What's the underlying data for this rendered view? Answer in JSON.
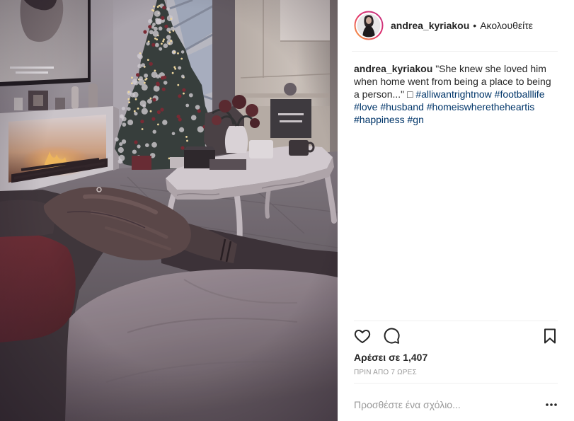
{
  "header": {
    "username": "andrea_kyriakou",
    "separator": "•",
    "follow_status": "Ακολουθείτε"
  },
  "caption": {
    "username": "andrea_kyriakou",
    "text": "\"She knew she loved him when home went from being a place to being a person...\" □",
    "hashtags": [
      "#alliwantrightnow",
      "#footballlife",
      "#love",
      "#husband",
      "#homeiswheretheheartis",
      "#happiness",
      "#gn"
    ]
  },
  "actions": {
    "like_icon": "heart-icon",
    "comment_icon": "comment-icon",
    "save_icon": "bookmark-icon"
  },
  "likes": {
    "text": "Αρέσει σε 1,407"
  },
  "timestamp": {
    "text": "ΠΡΙΝ ΑΠΟ 7 ΩΡΕΣ"
  },
  "comment_box": {
    "placeholder": "Προσθέστε ένα σχόλιο...",
    "more_icon": "more-options-icon"
  },
  "colors": {
    "text": "#262626",
    "hashtag": "#003569",
    "muted": "#999999",
    "divider": "#efefef",
    "avatar_ring": [
      "#f9a53a",
      "#e1306c",
      "#c13584"
    ]
  }
}
